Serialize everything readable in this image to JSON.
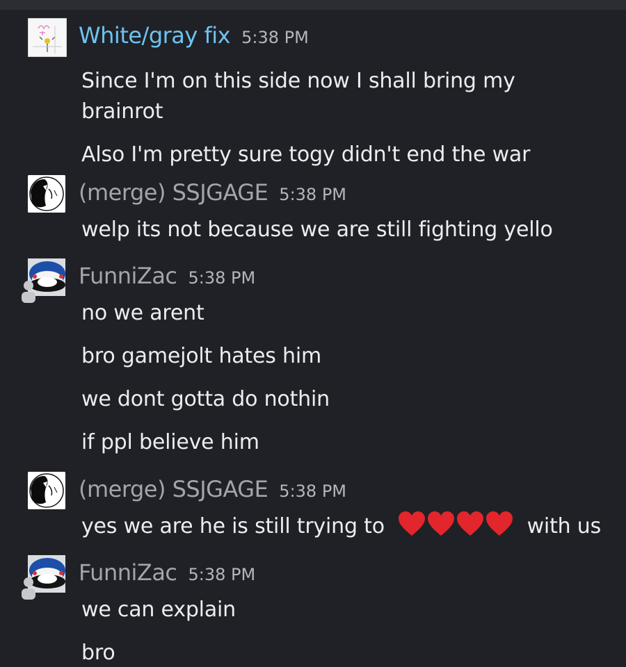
{
  "messages": [
    {
      "author": "White/gray fix",
      "author_color": "#6ec3f0",
      "time": "5:38 PM",
      "avatar": "white-gray-fix-avatar",
      "lines": [
        "Since I'm on this side now I shall bring my",
        "brainrot",
        "Also I'm pretty sure togy didn't end the war"
      ]
    },
    {
      "author": "(merge) SSJGAGE",
      "author_color": "#a2a5ad",
      "time": "5:38 PM",
      "avatar": "ssjgage-avatar",
      "lines": [
        "welp its not because we are still fighting yello"
      ]
    },
    {
      "author": "FunniZac",
      "author_color": "#a2a5ad",
      "time": "5:38 PM",
      "avatar": "funnizac-avatar",
      "lines": [
        "no we arent",
        "bro gamejolt hates him",
        "we dont gotta do nothin",
        "if ppl believe him"
      ]
    },
    {
      "author": "(merge) SSJGAGE",
      "author_color": "#a2a5ad",
      "time": "5:38 PM",
      "avatar": "ssjgage-avatar",
      "lines": [
        "yes we are he is still trying to",
        "with us"
      ],
      "emoji": "❤️❤️❤️❤️"
    },
    {
      "author": "FunniZac",
      "author_color": "#a2a5ad",
      "time": "5:38 PM",
      "avatar": "funnizac-avatar",
      "lines": [
        "we can explain",
        "bro"
      ]
    }
  ]
}
